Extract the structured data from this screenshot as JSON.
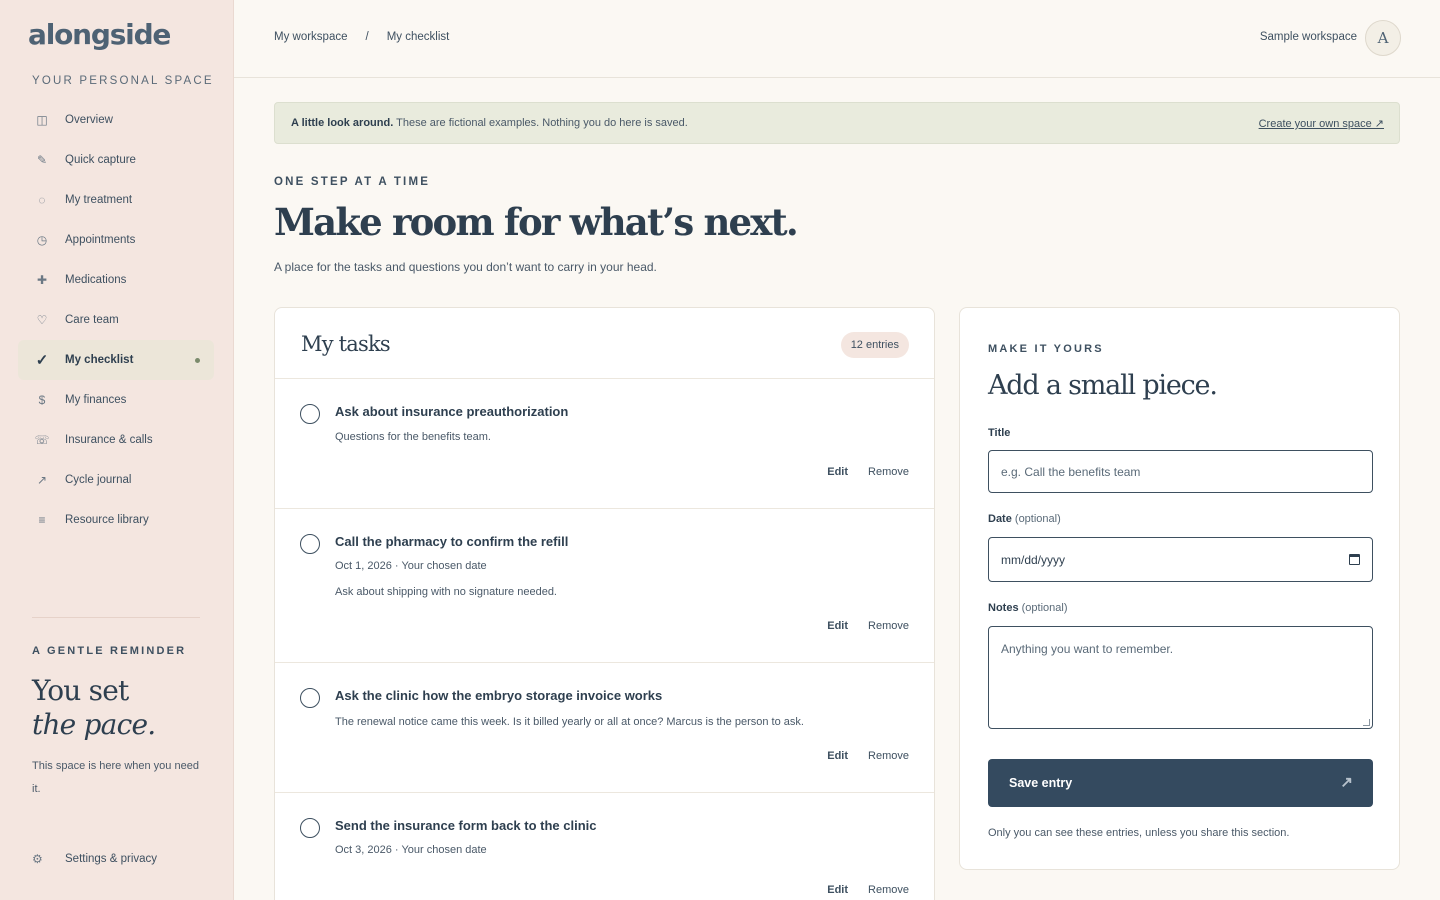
{
  "app": {
    "logo": "alongside",
    "caption": "YOUR PERSONAL SPACE"
  },
  "sidebar": {
    "items": [
      {
        "label": "Overview",
        "icon": "◫",
        "icon_name": "layout-icon"
      },
      {
        "label": "Quick capture",
        "icon": "✎",
        "icon_name": "pencil-icon"
      },
      {
        "label": "My treatment",
        "icon": "◌",
        "icon_name": "circle-icon"
      },
      {
        "label": "Appointments",
        "icon": "◷",
        "icon_name": "clock-icon"
      },
      {
        "label": "Medications",
        "icon": "✚",
        "icon_name": "plus-cross-icon"
      },
      {
        "label": "Care team",
        "icon": "♡",
        "icon_name": "heart-icon"
      },
      {
        "label": "My checklist",
        "icon": "✓",
        "icon_name": "check-icon",
        "active": true
      },
      {
        "label": "My finances",
        "icon": "$",
        "icon_name": "dollar-icon"
      },
      {
        "label": "Insurance & calls",
        "icon": "☏",
        "icon_name": "phone-icon"
      },
      {
        "label": "Cycle journal",
        "icon": "↗",
        "icon_name": "trend-arrow-icon"
      },
      {
        "label": "Resource library",
        "icon": "≡",
        "icon_name": "library-icon"
      }
    ],
    "reminder": {
      "caption": "A GENTLE REMINDER",
      "title_line1": "You set",
      "title_line2": "the pace.",
      "text": "This space is here when you need it."
    },
    "settings_label": "Settings & privacy",
    "settings_icon": "⚙"
  },
  "topbar": {
    "breadcrumb": [
      "My workspace",
      "My checklist"
    ],
    "separator": "/",
    "workspace": "Sample workspace",
    "avatar": "A"
  },
  "banner": {
    "bold": "A little look around.",
    "text": " These are fictional examples. Nothing you do here is saved.",
    "link": "Create your own space ↗"
  },
  "hero": {
    "eyebrow": "ONE STEP AT A TIME",
    "title": "Make room for what’s next.",
    "subtitle": "A place for the tasks and questions you don’t want to carry in your head."
  },
  "tasks": {
    "title": "My tasks",
    "count": "12 entries",
    "edit_label": "Edit",
    "remove_label": "Remove",
    "items": [
      {
        "title": "Ask about insurance preauthorization",
        "date": "",
        "note": "Questions for the benefits team."
      },
      {
        "title": "Call the pharmacy to confirm the refill",
        "date": "Oct 1, 2026 · Your chosen date",
        "note": "Ask about shipping with no signature needed."
      },
      {
        "title": "Ask the clinic how the embryo storage invoice works",
        "date": "",
        "note": "The renewal notice came this week. Is it billed yearly or all at once? Marcus is the person to ask."
      },
      {
        "title": "Send the insurance form back to the clinic",
        "date": "Oct 3, 2026 · Your chosen date",
        "note": ""
      }
    ]
  },
  "form": {
    "eyebrow": "MAKE IT YOURS",
    "title": "Add a small piece.",
    "title_label": "Title",
    "title_placeholder": "e.g. Call the benefits team",
    "date_label": "Date",
    "date_optional": "(optional)",
    "date_placeholder": "mm/dd/yyyy",
    "notes_label": "Notes",
    "notes_optional": "(optional)",
    "notes_placeholder": "Anything you want to remember.",
    "save_label": "Save entry",
    "save_icon": "↗",
    "note": "Only you can see these entries, unless you share this section."
  },
  "colors": {
    "sidebar_bg": "#f4e6e0",
    "page_bg": "#fbf8f3",
    "banner_bg": "#e9ebdd",
    "accent_dark": "#344a5f",
    "text": "#2e3f4f"
  }
}
